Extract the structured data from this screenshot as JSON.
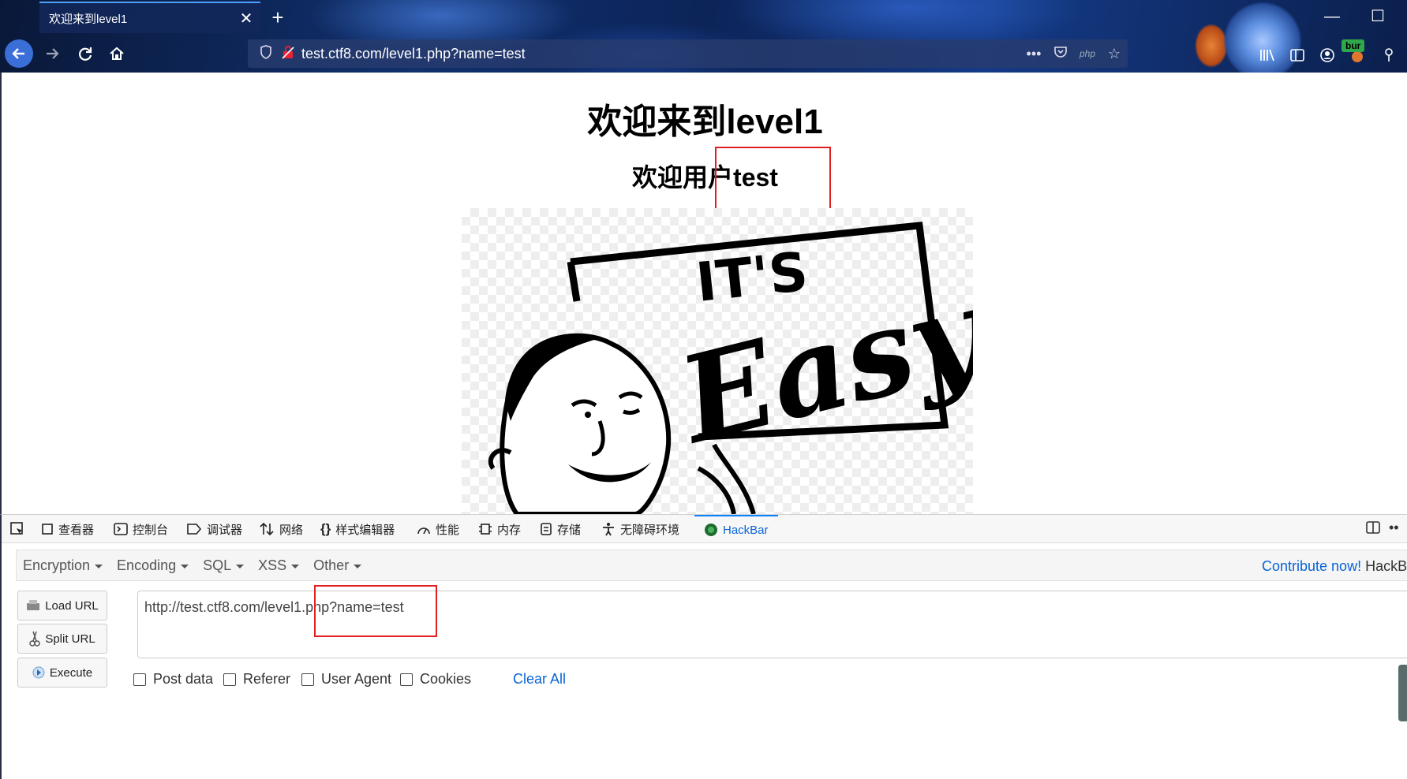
{
  "browser": {
    "tab_title": "欢迎来到level1",
    "url": "test.ctf8.com/level1.php?name=test",
    "php_badge": "php",
    "extension_badge": "bur"
  },
  "page": {
    "heading": "欢迎来到level1",
    "welcome": "欢迎用户test",
    "image_alt": "IT'S Easy"
  },
  "devtools": {
    "tabs": [
      "查看器",
      "控制台",
      "调试器",
      "网络",
      "样式编辑器",
      "性能",
      "内存",
      "存储",
      "无障碍环境",
      "HackBar"
    ],
    "active_tab": "HackBar"
  },
  "hackbar": {
    "menus": [
      "Encryption",
      "Encoding",
      "SQL",
      "XSS",
      "Other"
    ],
    "contribute": "Contribute now!",
    "contribute_suffix": "HackBa",
    "buttons": {
      "load": "Load URL",
      "split": "Split URL",
      "execute": "Execute"
    },
    "url_value": "http://test.ctf8.com/level1.php?name=test",
    "checkboxes": [
      "Post data",
      "Referer",
      "User Agent",
      "Cookies"
    ],
    "clear_all": "Clear All"
  },
  "colors": {
    "accent_blue": "#0a64d6",
    "highlight_red": "#e02020"
  }
}
